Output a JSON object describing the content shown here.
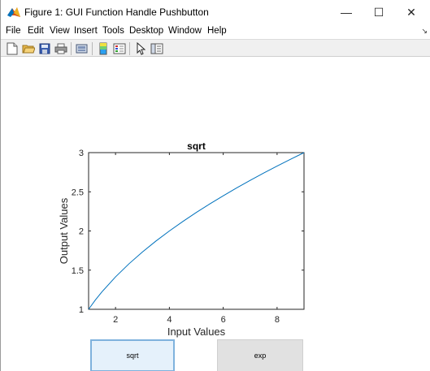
{
  "window": {
    "title": "Figure 1: GUI Function Handle Pushbutton",
    "minimize_glyph": "—",
    "maximize_glyph": "☐",
    "close_glyph": "✕"
  },
  "menu": {
    "items": [
      "File",
      "Edit",
      "View",
      "Insert",
      "Tools",
      "Desktop",
      "Window",
      "Help"
    ],
    "dock_glyph": "↘"
  },
  "toolbar": {
    "icons": [
      "new-figure-icon",
      "open-file-icon",
      "save-icon",
      "print-icon",
      "link-plot-icon",
      "colorbar-icon",
      "legend-icon",
      "pointer-icon",
      "property-inspector-icon"
    ]
  },
  "chart_data": {
    "type": "line",
    "title": "sqrt",
    "xlabel": "Input Values",
    "ylabel": "Output Values",
    "xlim": [
      1,
      9
    ],
    "ylim": [
      1,
      3
    ],
    "xticks": [
      2,
      4,
      6,
      8
    ],
    "yticks": [
      1,
      1.5,
      2,
      2.5,
      3
    ],
    "ytick_labels": [
      "1",
      "1.5",
      "2",
      "2.5",
      "3"
    ],
    "xtick_labels": [
      "2",
      "4",
      "6",
      "8"
    ],
    "grid": false,
    "series": [
      {
        "color": "#0072bd",
        "x": [
          1,
          1.25,
          1.5,
          2,
          2.5,
          3,
          3.5,
          4,
          4.5,
          5,
          5.5,
          6,
          6.5,
          7,
          7.5,
          8,
          8.5,
          9
        ],
        "y": [
          1,
          1.118,
          1.225,
          1.414,
          1.581,
          1.732,
          1.871,
          2,
          2.121,
          2.236,
          2.345,
          2.449,
          2.55,
          2.646,
          2.739,
          2.828,
          2.915,
          3
        ]
      }
    ]
  },
  "buttons": {
    "sqrt_label": "sqrt",
    "exp_label": "exp"
  }
}
